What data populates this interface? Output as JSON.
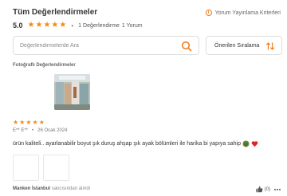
{
  "header": {
    "title": "Tüm Değerlendirmeler",
    "criteria_link": "Yorum Yayınlama Kriterleri",
    "info_icon": "i"
  },
  "summary": {
    "average": "5.0",
    "rating": 5,
    "rating_count_text": "1 Değerlendirme",
    "comment_count_text": "1 Yorum",
    "bullet": "•"
  },
  "search": {
    "placeholder": "Değerlendirmelerde Ara",
    "value": ""
  },
  "sort": {
    "selected": "Önerilen Sıralama"
  },
  "photos": {
    "section_title": "Fotoğraflı Değerlendirmeler"
  },
  "review": {
    "rating": 5,
    "author": "E** E**",
    "bullet": "•",
    "date": "26 Ocak 2024",
    "text": "ürün kaliteli.. ayarlanabilir boyut şık duruş ahşap şık ayak bölümleri ile harika bi yapıya sahip",
    "seller_name": "Manken İstanbul",
    "seller_suffix": "satıcısından alındı",
    "likes": "(0)"
  },
  "colors": {
    "accent": "#f27a1a",
    "star": "#f28c1a"
  },
  "icons": {
    "star": "★",
    "search": "search-icon",
    "sort": "sort-arrows-icon",
    "like": "thumbs-up-icon",
    "more": "more-dots-icon"
  }
}
